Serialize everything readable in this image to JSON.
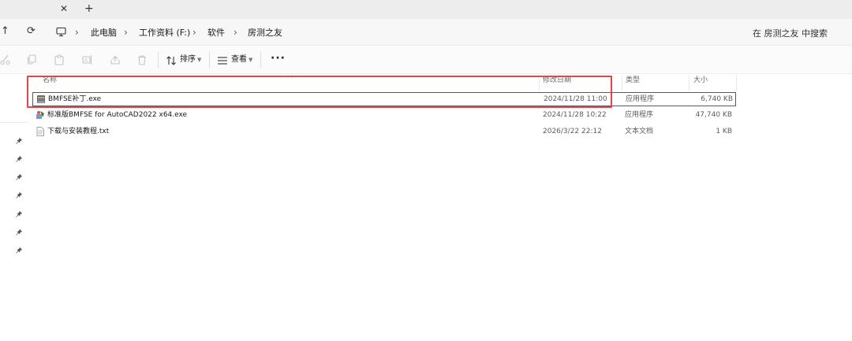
{
  "tabbar": {
    "close_glyph": "✕",
    "new_tab_glyph": "+"
  },
  "nav": {
    "up_glyph": "↑",
    "refresh_glyph": "⟳"
  },
  "breadcrumb": [
    {
      "label": "此电脑"
    },
    {
      "label": "工作资料 (F:)"
    },
    {
      "label": "软件"
    },
    {
      "label": "房测之友"
    }
  ],
  "breadcrumb_separator": "›",
  "search": {
    "placeholder": "在 房测之友 中搜索"
  },
  "commandbar": {
    "sort_label": "排序",
    "view_label": "查看",
    "more_label": "···",
    "disabled_icons": [
      "cut-icon",
      "copy-icon",
      "paste-icon",
      "rename-icon",
      "share-icon",
      "delete-icon"
    ]
  },
  "columns": {
    "name": "名称",
    "modified": "修改日期",
    "type": "类型",
    "size": "大小"
  },
  "files": [
    {
      "name": "BMFSE补丁.exe",
      "modified": "2024/11/28 11:00",
      "type": "应用程序",
      "size": "6,740 KB",
      "icon": "exe-installer-icon",
      "selected": true
    },
    {
      "name": "标准版BMFSE for AutoCAD2022 x64.exe",
      "modified": "2024/11/28 10:22",
      "type": "应用程序",
      "size": "47,740 KB",
      "icon": "app-setup-icon",
      "selected": false
    },
    {
      "name": "下载与安装教程.txt",
      "modified": "2026/3/22 22:12",
      "type": "文本文档",
      "size": "1 KB",
      "icon": "text-file-icon",
      "selected": false
    }
  ],
  "colors": {
    "highlight": "#e0474c",
    "selection_border": "#595959",
    "pin": "#555555"
  }
}
